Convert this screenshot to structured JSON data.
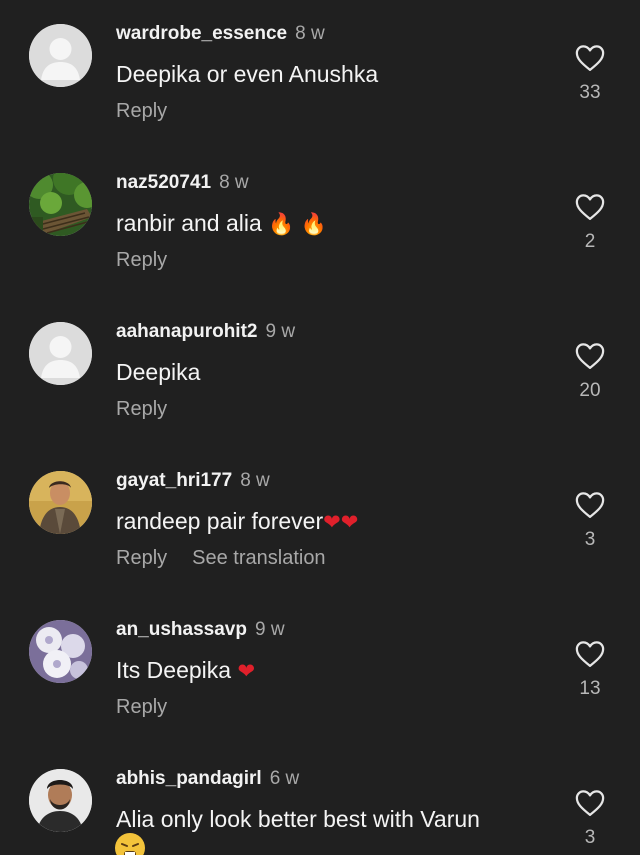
{
  "comments": [
    {
      "username": "wardrobe_essence",
      "time": "8 w",
      "text": "Deepika or even Anushka",
      "reply": "Reply",
      "likes": "33",
      "avatar": "default-avatar"
    },
    {
      "username": "naz520741",
      "time": "8 w",
      "text": "ranbir and alia",
      "emoji": [
        "fire",
        "fire"
      ],
      "reply": "Reply",
      "likes": "2",
      "avatar": "forest-path-photo"
    },
    {
      "username": "aahanapurohit2",
      "time": "9 w",
      "text": "Deepika",
      "reply": "Reply",
      "likes": "20",
      "avatar": "default-avatar"
    },
    {
      "username": "gayat_hri177",
      "time": "8 w",
      "text": "randeep pair forever",
      "emoji": [
        "red-heart",
        "red-heart"
      ],
      "reply": "Reply",
      "translation": "See translation",
      "likes": "3",
      "avatar": "man-portrait-photo"
    },
    {
      "username": "an_ushassavp",
      "time": "9 w",
      "text": "Its Deepika",
      "emoji": [
        "red-heart"
      ],
      "reply": "Reply",
      "likes": "13",
      "avatar": "white-flowers-photo"
    },
    {
      "username": "abhis_pandagirl",
      "time": "6 w",
      "text": "Alia only look better best with Varun",
      "emoji": [
        "tired-face"
      ],
      "likes": "3",
      "avatar": "man-portrait-photo"
    }
  ],
  "colors": {
    "background": "#202020",
    "username": "#f2f2f2",
    "secondary": "#a8a8a8",
    "fire_emoji": "#ff8a1c",
    "heart_emoji": "#e0202b"
  }
}
